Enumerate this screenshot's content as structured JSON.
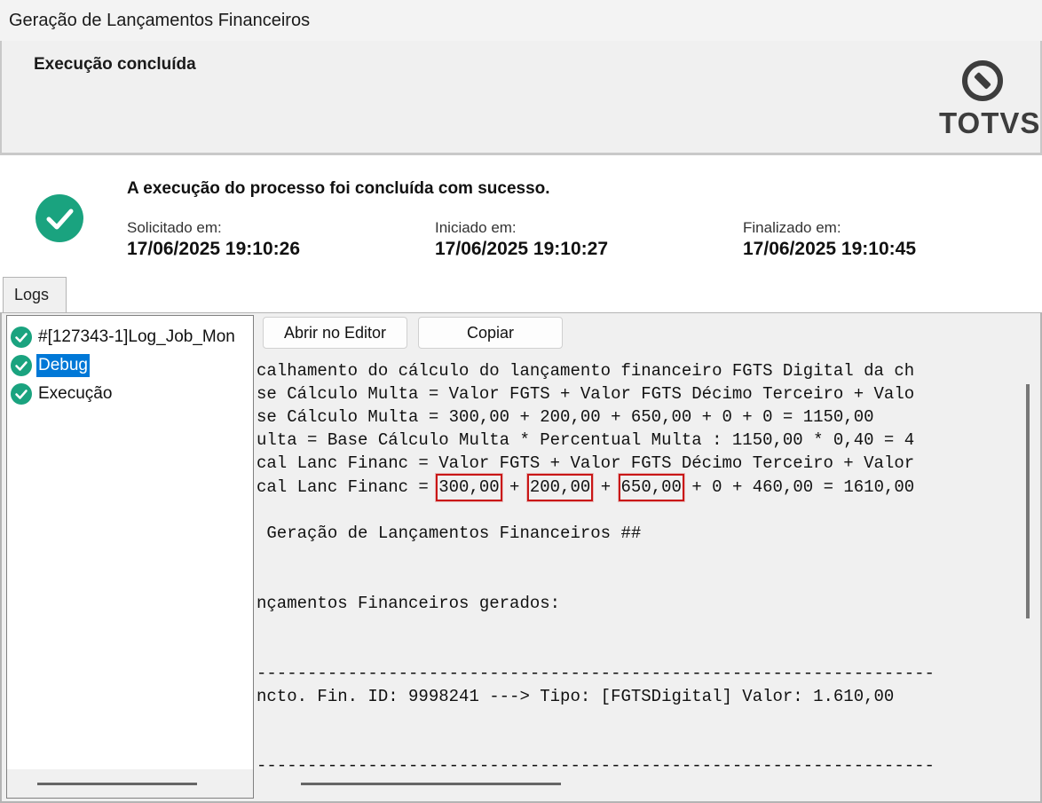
{
  "window": {
    "title": "Geração de Lançamentos Financeiros"
  },
  "header": {
    "subtitle": "Execução concluída",
    "logo_text": "TOTVS",
    "logo_icon": "totvs-logo-icon"
  },
  "status": {
    "message": "A execução do processo foi concluída com sucesso.",
    "requested": {
      "label": "Solicitado em:",
      "value": "17/06/2025 19:10:26"
    },
    "started": {
      "label": "Iniciado em:",
      "value": "17/06/2025 19:10:27"
    },
    "finished": {
      "label": "Finalizado em:",
      "value": "17/06/2025 19:10:45"
    },
    "icon": "check-circle-icon",
    "color": "#1aa37f"
  },
  "tabs": {
    "logs": "Logs"
  },
  "tree": {
    "items": [
      {
        "label": "#[127343-1]Log_Job_Mon",
        "selected": false
      },
      {
        "label": "Debug",
        "selected": true
      },
      {
        "label": "Execução",
        "selected": false
      }
    ]
  },
  "toolbar": {
    "open_editor": "Abrir no Editor",
    "copy": "Copiar"
  },
  "log": {
    "line1": "calhamento do cálculo do lançamento financeiro FGTS Digital da ch",
    "line2": "se Cálculo Multa = Valor FGTS + Valor FGTS Décimo Terceiro + Valo",
    "line3": "se Cálculo Multa = 300,00 + 200,00 + 650,00 + 0 + 0 = 1150,00",
    "line4": "ulta = Base Cálculo Multa * Percentual Multa : 1150,00 * 0,40 = 4",
    "line5": "cal Lanc Financ = Valor FGTS + Valor FGTS Décimo Terceiro + Valor",
    "line6": {
      "prefix": "cal Lanc Financ = ",
      "v1": "300,00",
      "sep1": " + ",
      "v2": "200,00",
      "sep2": " + ",
      "v3": "650,00",
      "suffix": " + 0 + 460,00 = 1610,00"
    },
    "line7": " Geração de Lançamentos Financeiros ##",
    "line8": "nçamentos Financeiros gerados:",
    "line9": "-------------------------------------------------------------------",
    "line10": "ncto. Fin. ID: 9998241 ---> Tipo: [FGTSDigital] Valor: 1.610,00",
    "line11": "-------------------------------------------------------------------"
  },
  "colors": {
    "highlight": "#c91616",
    "selection": "#0078d7"
  }
}
